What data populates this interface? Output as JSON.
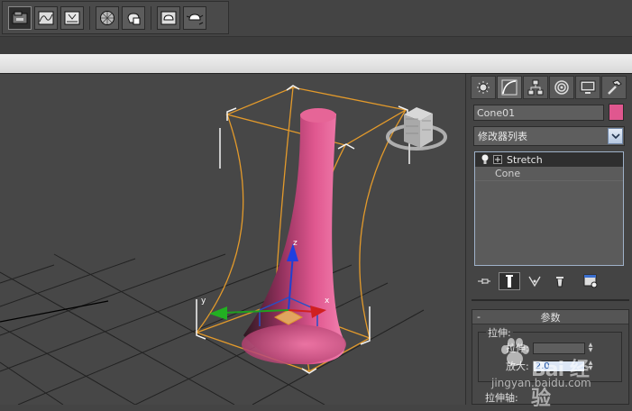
{
  "toolbar": {
    "buttons": [
      "open-file-icon",
      "curve-editor-icon",
      "render-setup-icon",
      "material-editor-icon",
      "render-frame-icon",
      "render-teapot-icon",
      "quick-render-icon"
    ]
  },
  "viewport": {
    "axis_labels": {
      "x": "x",
      "y": "y",
      "z": "z"
    },
    "object_color": "#e0578f"
  },
  "command_panel": {
    "tabs": [
      "create-tab",
      "modify-tab",
      "hierarchy-tab",
      "motion-tab",
      "display-tab",
      "utilities-tab"
    ],
    "object_name": "Cone01",
    "object_color": "#e0578f",
    "modifier_list_label": "修改器列表",
    "stack": [
      {
        "label": "Stretch",
        "selected": true
      },
      {
        "label": "Cone",
        "selected": false
      }
    ],
    "parameters": {
      "collapse_sign": "-",
      "title": "参数",
      "stretch_group_label": "拉伸:",
      "stretch_label": "拉伸:",
      "amplify_label": "放大:",
      "amplify_value": "2.0",
      "stretch_axis_label": "拉伸轴:"
    }
  },
  "watermark": {
    "brand": "Bai 经验",
    "url": "jingyan.baidu.com"
  }
}
